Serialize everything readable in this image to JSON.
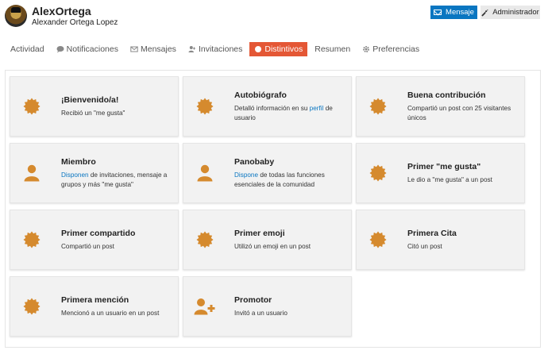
{
  "colors": {
    "accent": "#e45735",
    "link": "#0a76c1",
    "badge": "#d58a2e",
    "card_bg": "#f2f2f2"
  },
  "user": {
    "username": "AlexOrtega",
    "full_name": "Alexander Ortega Lopez"
  },
  "actions": {
    "message_label": "Mensaje",
    "admin_label": "Administrador"
  },
  "tabs": [
    {
      "label": "Actividad",
      "icon": ""
    },
    {
      "label": "Notificaciones",
      "icon": "comment-icon"
    },
    {
      "label": "Mensajes",
      "icon": "envelope-icon"
    },
    {
      "label": "Invitaciones",
      "icon": "user-plus-icon"
    },
    {
      "label": "Distintivos",
      "icon": "circle-icon",
      "active": true
    },
    {
      "label": "Resumen",
      "icon": ""
    },
    {
      "label": "Preferencias",
      "icon": "gear-icon"
    }
  ],
  "badges": [
    {
      "icon": "certificate-icon",
      "title": "¡Bienvenido/a!",
      "desc": [
        "Recibió un \"me gusta\""
      ]
    },
    {
      "icon": "certificate-icon",
      "title": "Autobiógrafo",
      "desc": [
        "Detalló información en su ",
        {
          "link": "perfil"
        },
        " de usuario"
      ]
    },
    {
      "icon": "certificate-icon",
      "title": "Buena contribución",
      "desc": [
        "Compartió un post con 25 visitantes únicos"
      ]
    },
    {
      "icon": "user-icon",
      "title": "Miembro",
      "desc": [
        {
          "link": "Disponen"
        },
        " de invitaciones, mensaje a grupos y más \"me gusta\""
      ]
    },
    {
      "icon": "user-icon",
      "title": "Panobaby",
      "desc": [
        {
          "link": "Dispone"
        },
        " de todas las funciones esenciales de la comunidad"
      ]
    },
    {
      "icon": "certificate-icon",
      "title": "Primer \"me gusta\"",
      "desc": [
        "Le dio a \"me gusta\" a un post"
      ]
    },
    {
      "icon": "certificate-icon",
      "title": "Primer compartido",
      "desc": [
        "Compartió un post"
      ]
    },
    {
      "icon": "certificate-icon",
      "title": "Primer emoji",
      "desc": [
        "Utilizó un emoji en un post"
      ]
    },
    {
      "icon": "certificate-icon",
      "title": "Primera Cita",
      "desc": [
        "Citó un post"
      ]
    },
    {
      "icon": "certificate-icon",
      "title": "Primera mención",
      "desc": [
        "Mencionó a un usuario en un post"
      ]
    },
    {
      "icon": "user-plus-icon",
      "title": "Promotor",
      "desc": [
        "Invitó a un usuario"
      ]
    }
  ]
}
